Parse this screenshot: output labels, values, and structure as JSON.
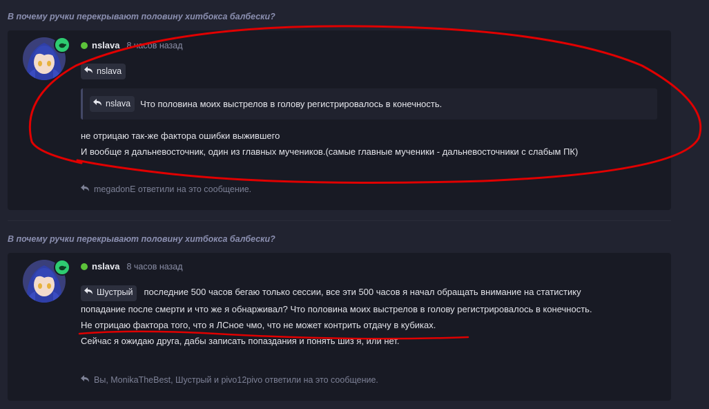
{
  "accent": "#e00000",
  "posts": [
    {
      "thread_title": "В почему ручки перекрывают половину хитбокса балбески?",
      "author": "nslava",
      "time": "8 часов назад",
      "reply_to_chip": "nslava",
      "quote_author": "nslava",
      "quote_text": "Что половина моих выстрелов в голову регистрировалось в конечность.",
      "lines": [
        "не отрицаю так-же фактора ошибки выжившего",
        "И вообще я дальневосточник, один из главных мучеников.(самые главные мученики - дальневосточники с слабым ПК)"
      ],
      "replies_text": "megadonE ответили на это сообщение."
    },
    {
      "thread_title": "В почему ручки перекрывают половину хитбокса балбески?",
      "author": "nslava",
      "time": "8 часов назад",
      "reply_to_chip": "Шустрый",
      "lines": [
        "последние 500 часов бегаю только сессии, все эти 500 часов я начал обращать внимание на статистику",
        "попадание после смерти и что же я обнарживал? Что половина моих выстрелов в голову регистрировалось в конечность.",
        "Не отрицаю фактора того, что я ЛСное чмо, что не может контрить отдачу в кубиках.",
        "Сейчас я ожидаю друга, дабы записать попаздания и понять шиз я, или нет."
      ],
      "replies_text": "Вы, MonikaTheBest, Шустрый и pivo12pivo ответили на это сообщение."
    }
  ]
}
